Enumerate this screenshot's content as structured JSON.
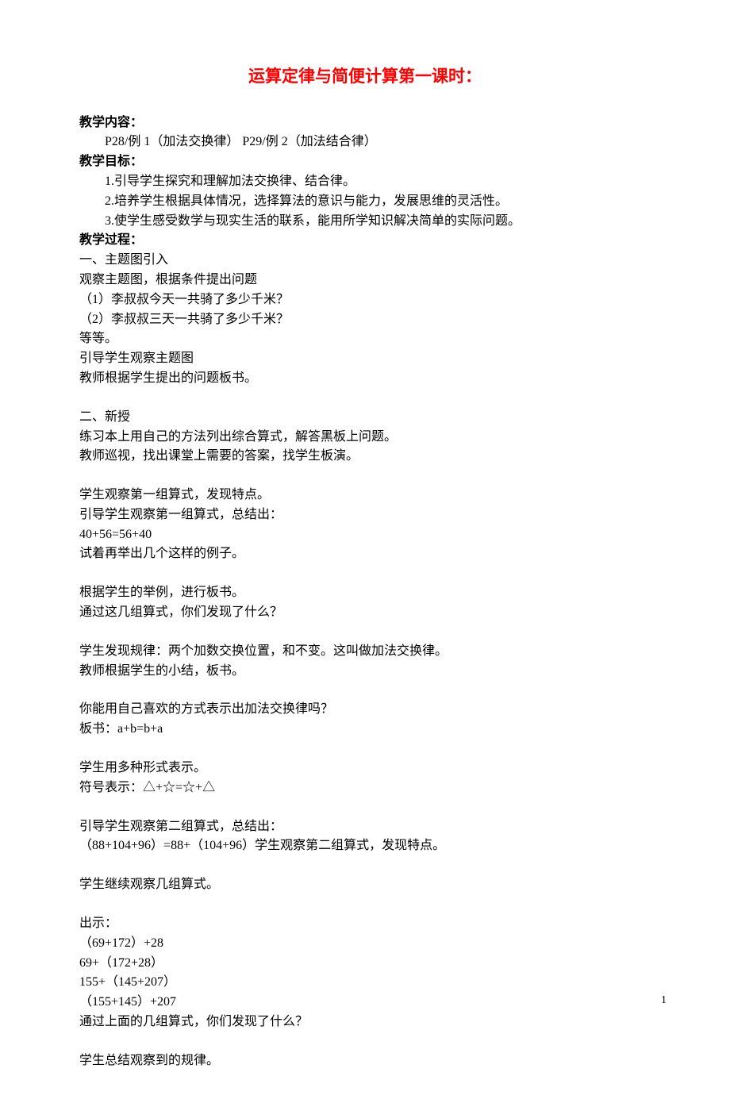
{
  "title": "运算定律与简便计算第一课时：",
  "section1_header": "教学内容：",
  "content_line": "P28/例 1（加法交换律）  P29/例 2（加法结合律）",
  "section2_header": "教学目标：",
  "goals": [
    "1.引导学生探究和理解加法交换律、结合律。",
    "2.培养学生根据具体情况，选择算法的意识与能力，发展思维的灵活性。",
    "3.使学生感受数学与现实生活的联系，能用所学知识解决简单的实际问题。"
  ],
  "section3_header": "教学过程：",
  "part1_title": "一、主题图引入",
  "p1_lines": [
    "观察主题图，根据条件提出问题",
    "（1）李叔叔今天一共骑了多少千米？",
    "（2）李叔叔三天一共骑了多少千米？",
    "等等。",
    "引导学生观察主题图",
    "教师根据学生提出的问题板书。"
  ],
  "part2_title": "二、新授",
  "p2_block1": [
    "练习本上用自己的方法列出综合算式，解答黑板上问题。",
    "教师巡视，找出课堂上需要的答案，找学生板演。"
  ],
  "p2_block2": [
    "学生观察第一组算式，发现特点。",
    "引导学生观察第一组算式，总结出：",
    "40+56=56+40",
    "试着再举出几个这样的例子。"
  ],
  "p2_block3": [
    "根据学生的举例，进行板书。",
    "通过这几组算式，你们发现了什么？"
  ],
  "p2_block4": [
    "学生发现规律：两个加数交换位置，和不变。这叫做加法交换律。",
    "教师根据学生的小结，板书。"
  ],
  "p2_block5": [
    "你能用自己喜欢的方式表示出加法交换律吗？",
    "板书：a+b=b+a"
  ],
  "p2_block6": [
    "学生用多种形式表示。",
    "符号表示：△+☆=☆+△"
  ],
  "p2_block7": [
    "引导学生观察第二组算式，总结出：",
    "（88+104+96）=88+（104+96）学生观察第二组算式，发现特点。"
  ],
  "p2_block8": [
    "学生继续观察几组算式。"
  ],
  "p2_block9": [
    "出示：",
    "（69+172）+28",
    "69+（172+28）",
    "155+（145+207）",
    "（155+145）+207",
    "通过上面的几组算式，你们发现了什么？"
  ],
  "p2_block10": [
    "学生总结观察到的规律。"
  ],
  "page_number": "1"
}
